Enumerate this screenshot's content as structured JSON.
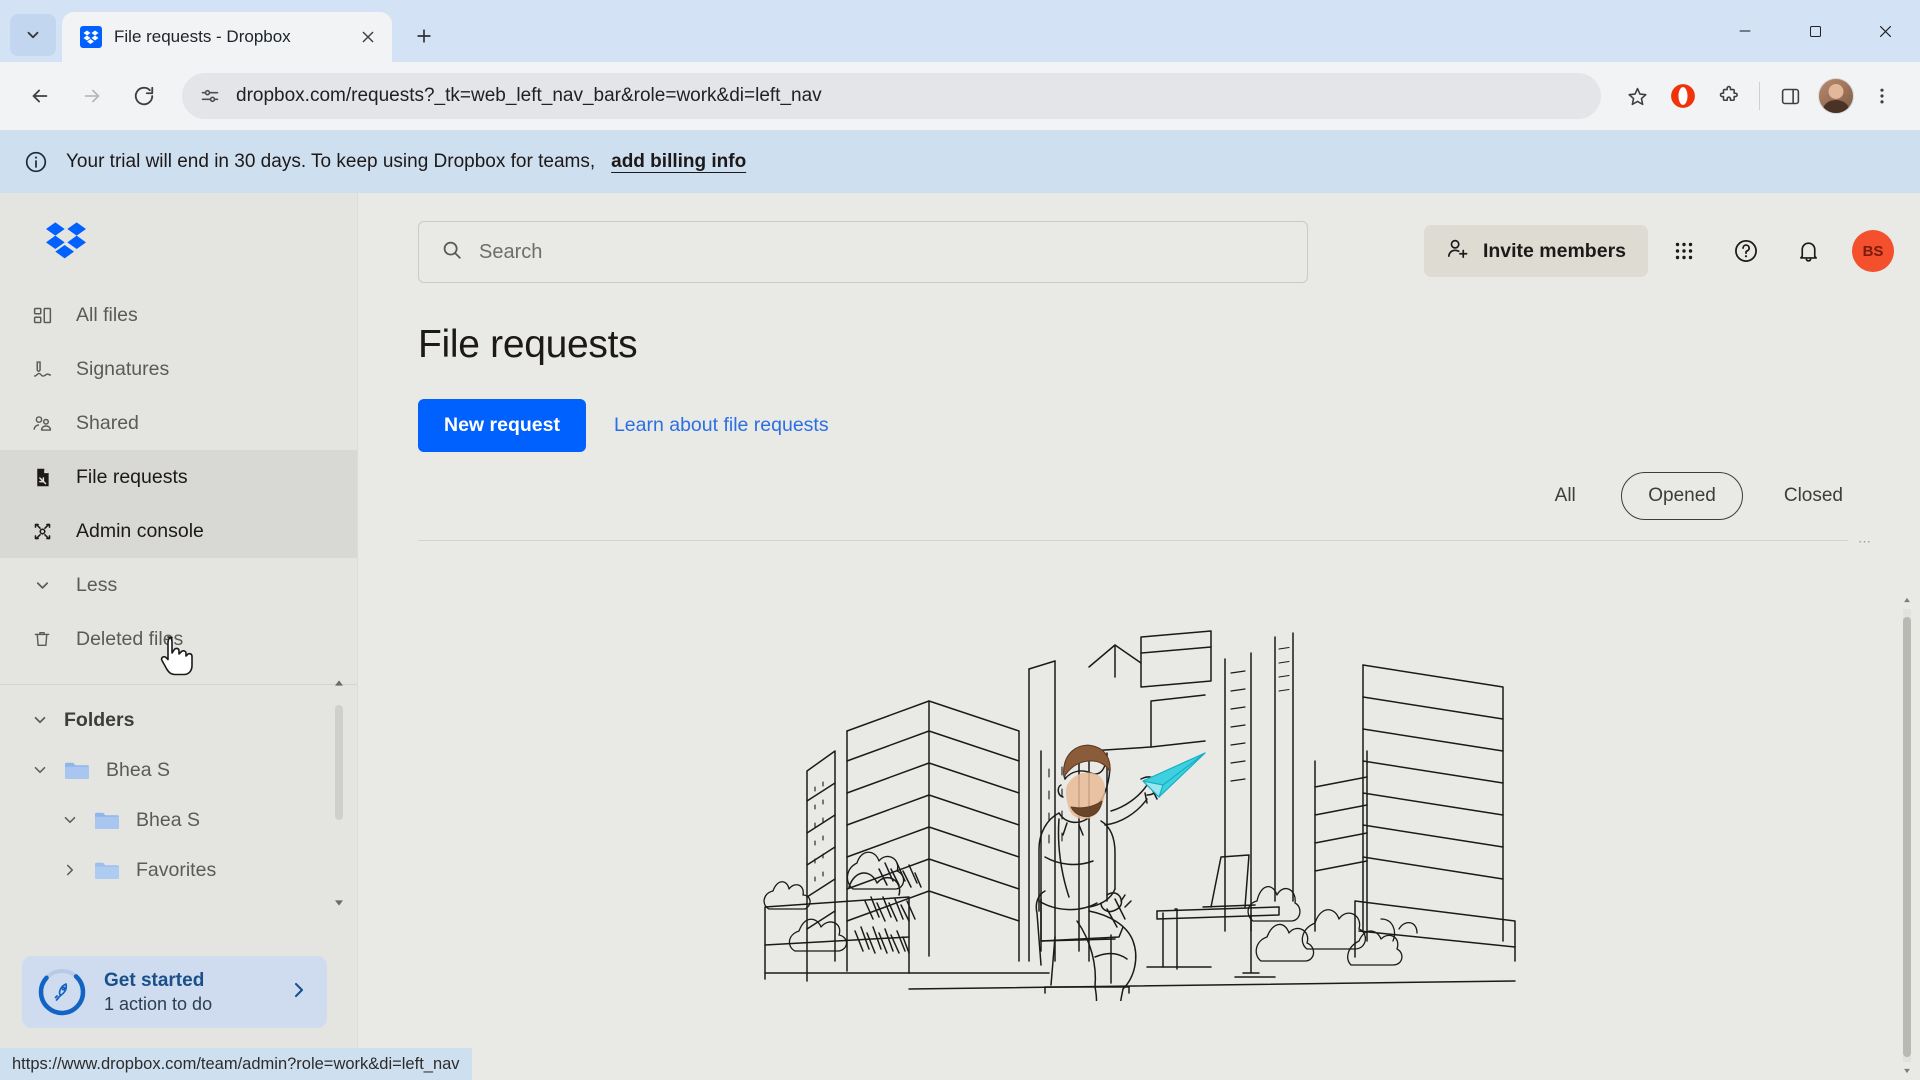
{
  "browser": {
    "tab": {
      "title": "File requests - Dropbox",
      "favicon": "dropbox-icon",
      "close_label": "×"
    },
    "tab_list_icon": "chevron-down-icon",
    "new_tab_icon": "plus-icon",
    "window_controls": {
      "minimize": "minimize-icon",
      "maximize": "maximize-icon",
      "close": "close-icon"
    },
    "toolbar": {
      "back_icon": "arrow-left-icon",
      "forward_icon": "arrow-right-icon",
      "reload_icon": "reload-icon",
      "site_info_icon": "site-settings-icon",
      "url": "dropbox.com/requests?_tk=web_left_nav_bar&role=work&di=left_nav",
      "bookmark_icon": "star-icon",
      "extension_icon": "puzzle-icon",
      "sidepanel_icon": "side-panel-icon",
      "menu_icon": "kebab-menu-icon",
      "profile_icon": "profile-avatar"
    },
    "status_bar_url": "https://www.dropbox.com/team/admin?role=work&di=left_nav"
  },
  "banner": {
    "icon": "info-icon",
    "text": "Your trial will end in 30 days. To keep using Dropbox for teams,",
    "link": "add billing info"
  },
  "sidebar": {
    "logo": "dropbox-logo",
    "nav": [
      {
        "label": "All files",
        "icon": "all-files-icon",
        "state": "default"
      },
      {
        "label": "Signatures",
        "icon": "signature-icon",
        "state": "default"
      },
      {
        "label": "Shared",
        "icon": "shared-users-icon",
        "state": "default"
      },
      {
        "label": "File requests",
        "icon": "file-request-icon",
        "state": "active"
      },
      {
        "label": "Admin console",
        "icon": "admin-console-icon",
        "state": "hover"
      },
      {
        "label": "Less",
        "icon": "chevron-down-icon",
        "state": "default"
      },
      {
        "label": "Deleted files",
        "icon": "trash-icon",
        "state": "default"
      }
    ],
    "folders": {
      "header": "Folders",
      "items": [
        {
          "label": "Bhea S",
          "caret": "chevron-down-icon",
          "depth": 0
        },
        {
          "label": "Bhea S",
          "caret": "chevron-down-icon",
          "depth": 1
        },
        {
          "label": "Favorites",
          "caret": "chevron-right-icon",
          "depth": 1
        }
      ]
    },
    "get_started": {
      "title": "Get started",
      "subtitle": "1 action to do",
      "icon": "rocket-icon",
      "chevron": "chevron-right-icon",
      "progress_percent": 75
    }
  },
  "header": {
    "search_placeholder": "Search",
    "search_icon": "search-icon",
    "invite_label": "Invite members",
    "invite_icon": "person-add-icon",
    "apps_icon": "grid-apps-icon",
    "help_icon": "question-circle-icon",
    "notifications_icon": "bell-icon",
    "avatar_initials": "BS"
  },
  "main": {
    "title": "File requests",
    "primary_button": "New request",
    "learn_link": "Learn about file requests",
    "filters": [
      {
        "label": "All",
        "selected": false
      },
      {
        "label": "Opened",
        "selected": true
      },
      {
        "label": "Closed",
        "selected": false
      }
    ],
    "illustration": "man-with-paper-plane-in-city-illustration"
  },
  "colors": {
    "dropbox_blue": "#0061fe",
    "banner_bg": "#cedff0",
    "sidebar_bg": "#e4e4e1",
    "main_bg": "#e9e9e6",
    "avatar_red": "#f4502d",
    "paper_plane_cyan": "#3fd0e0"
  }
}
